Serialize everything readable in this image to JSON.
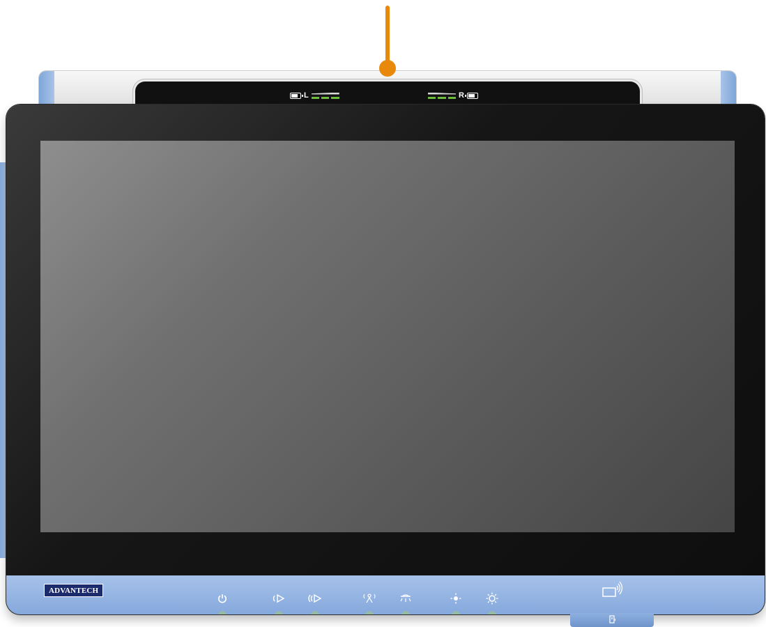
{
  "device": {
    "brand": "ADVANTECH",
    "left_battery_label": "L",
    "right_battery_label": "R"
  },
  "icons": [
    "power-icon",
    "volume-down-icon",
    "volume-up-icon",
    "nurse-call-icon",
    "reading-light-icon",
    "brightness-down-icon",
    "brightness-up-icon",
    "nfc-reader-icon",
    "card-slot-icon",
    "battery-icon"
  ],
  "colors": {
    "callout": "#e8890c",
    "accent_blue": "#85a8dc",
    "battery_led": "#6dbb3a",
    "logo_bg": "#1b2b6b"
  }
}
